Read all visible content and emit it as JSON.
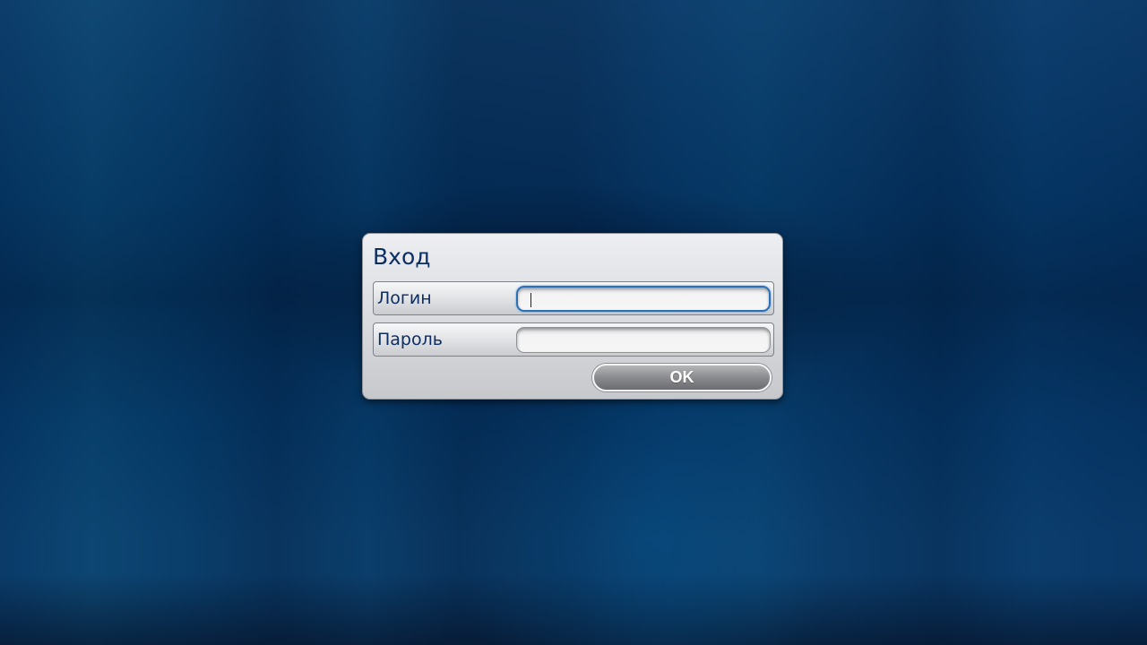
{
  "login_dialog": {
    "title": "Вход",
    "login_field": {
      "label": "Логин",
      "value": "",
      "placeholder": ""
    },
    "password_field": {
      "label": "Пароль",
      "value": "",
      "placeholder": ""
    },
    "ok_label": "OK"
  },
  "colors": {
    "background": "#043361",
    "title_text": "#0c2e63",
    "focus_border": "#2b6fb6",
    "button_fill": "#8a8b8e"
  }
}
